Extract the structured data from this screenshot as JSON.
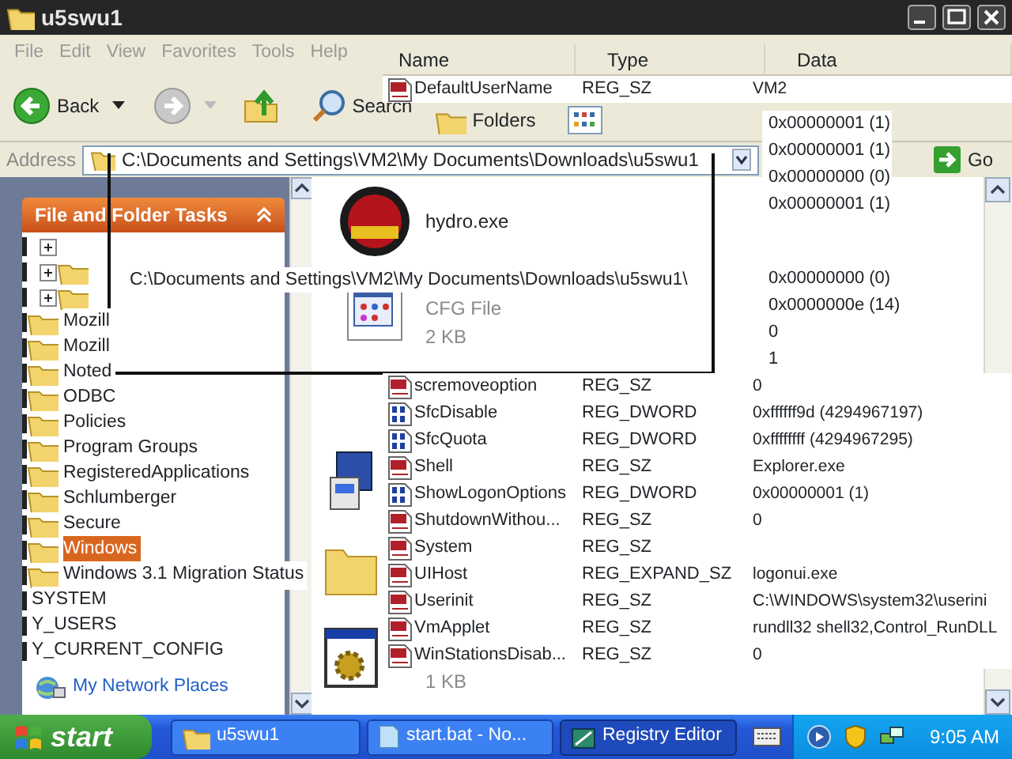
{
  "explorer": {
    "title": "u5swu1",
    "menu": [
      "File",
      "Edit",
      "View",
      "Favorites",
      "Tools",
      "Help"
    ],
    "toolbar": {
      "back": "Back",
      "search": "Search",
      "folders": "Folders"
    },
    "address": {
      "label": "Address",
      "value": "C:\\Documents and Settings\\VM2\\My Documents\\Downloads\\u5swu1",
      "go": "Go"
    },
    "tasks_panel": {
      "title": "File and Folder Tasks",
      "expanded": true
    },
    "other_places": {
      "link": "My Network Places"
    },
    "files": [
      {
        "kind": "exe",
        "name": "hydro.exe"
      },
      {
        "kind": "cfg",
        "type": "CFG File",
        "size": "2 KB"
      },
      {
        "kind": "setup"
      },
      {
        "kind": "folder"
      },
      {
        "kind": "bat",
        "size": "1 KB"
      }
    ]
  },
  "path_edit": {
    "value": "C:\\Documents and Settings\\VM2\\My Documents\\Downloads\\u5swu1\\"
  },
  "registry": {
    "columns": [
      "Name",
      "Type",
      "Data"
    ],
    "row_groups": [
      {
        "rows": [
          {
            "kind": "string",
            "name": "DefaultUserName",
            "type": "REG_SZ",
            "data": "VM2"
          }
        ]
      },
      {
        "rows": [
          {
            "data": "0x00000001 (1)"
          },
          {
            "data": "0x00000001 (1)"
          },
          {
            "data": "0x00000000 (0)"
          },
          {
            "data": "0x00000001 (1)"
          }
        ]
      },
      {
        "rows": [
          {
            "data": "0x00000000 (0)"
          },
          {
            "data": "0x0000000e (14)"
          },
          {
            "data": "0"
          },
          {
            "data": "1"
          }
        ]
      },
      {
        "rows": [
          {
            "kind": "string",
            "name": "scremoveoption",
            "type": "REG_SZ",
            "data": "0"
          },
          {
            "kind": "dword",
            "name": "SfcDisable",
            "type": "REG_DWORD",
            "data": "0xffffff9d (4294967197)"
          },
          {
            "kind": "dword",
            "name": "SfcQuota",
            "type": "REG_DWORD",
            "data": "0xffffffff (4294967295)"
          },
          {
            "kind": "string",
            "name": "Shell",
            "type": "REG_SZ",
            "data": "Explorer.exe"
          },
          {
            "kind": "dword",
            "name": "ShowLogonOptions",
            "type": "REG_DWORD",
            "data": "0x00000001 (1)"
          },
          {
            "kind": "string",
            "name": "ShutdownWithou...",
            "type": "REG_SZ",
            "data": "0"
          },
          {
            "kind": "string",
            "name": "System",
            "type": "REG_SZ"
          },
          {
            "kind": "string",
            "name": "UIHost",
            "type": "REG_EXPAND_SZ",
            "data": "logonui.exe"
          },
          {
            "kind": "string",
            "name": "Userinit",
            "type": "REG_SZ",
            "data": "C:\\WINDOWS\\system32\\userini"
          },
          {
            "kind": "string",
            "name": "VmApplet",
            "type": "REG_SZ",
            "data": "rundll32 shell32,Control_RunDLL"
          },
          {
            "kind": "string",
            "name": "WinStationsDisab...",
            "type": "REG_SZ",
            "data": "0"
          }
        ]
      }
    ]
  },
  "tree": {
    "items": [
      {
        "kind": "expander"
      },
      {
        "kind": "expander-folder"
      },
      {
        "kind": "expander-folder"
      },
      {
        "kind": "folder",
        "label": "Mozill",
        "selected": false
      },
      {
        "kind": "folder",
        "label": "Mozill",
        "selected": false
      },
      {
        "kind": "folder",
        "label": "Noted",
        "selected": false
      },
      {
        "kind": "folder",
        "label": "ODBC",
        "selected": false
      },
      {
        "kind": "folder",
        "label": "Policies",
        "selected": false
      },
      {
        "kind": "folder",
        "label": "Program Groups",
        "selected": false
      },
      {
        "kind": "folder",
        "label": "RegisteredApplications",
        "selected": false
      },
      {
        "kind": "folder",
        "label": "Schlumberger",
        "selected": false
      },
      {
        "kind": "folder",
        "label": "Secure",
        "selected": false
      },
      {
        "kind": "folder",
        "label": "Windows",
        "selected": true
      },
      {
        "kind": "folder",
        "label": "Windows 3.1 Migration Status",
        "selected": false
      },
      {
        "kind": "hive",
        "label": "SYSTEM",
        "selected": false
      },
      {
        "kind": "hive",
        "label": "Y_USERS",
        "selected": false
      },
      {
        "kind": "hive",
        "label": "Y_CURRENT_CONFIG",
        "selected": false
      }
    ]
  },
  "taskbar": {
    "start": "start",
    "tasks": [
      {
        "kind": "folder",
        "label": "u5swu1",
        "selected": false
      },
      {
        "kind": "notepad",
        "label": "start.bat - No...",
        "selected": false
      },
      {
        "kind": "regedit",
        "label": "Registry Editor",
        "selected": true
      }
    ],
    "clock": "9:05 AM"
  }
}
